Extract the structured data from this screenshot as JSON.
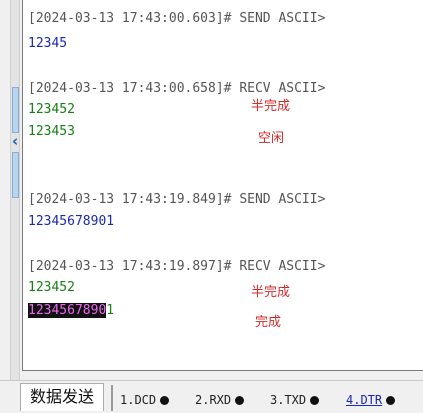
{
  "log": {
    "entries": [
      {
        "header": "[2024-03-13 17:43:00.603]# SEND ASCII>",
        "lines": [
          "12345"
        ]
      },
      {
        "header": "[2024-03-13 17:43:00.658]# RECV ASCII>",
        "lines": [
          "123452",
          "123453"
        ]
      },
      {
        "header": "[2024-03-13 17:43:19.849]# SEND ASCII>",
        "lines": [
          "12345678901"
        ]
      },
      {
        "header": "[2024-03-13 17:43:19.897]# RECV ASCII>",
        "lines": [
          "123452"
        ],
        "selected_text": "1234567890",
        "unselected_text": "1"
      }
    ]
  },
  "annotations": {
    "half_complete_1": "半完成",
    "idle": "空闲",
    "half_complete_2": "半完成",
    "complete": "完成"
  },
  "bottom_bar": {
    "tab_label": "数据发送",
    "signals": [
      {
        "label": "1.DCD",
        "icon": "dot-icon"
      },
      {
        "label": "2.RXD",
        "icon": "dot-icon"
      },
      {
        "label": "3.TXD",
        "icon": "dot-icon"
      },
      {
        "label": "4.DTR",
        "icon": "dot-icon",
        "active": true
      }
    ]
  },
  "colors": {
    "send_text": "#1a28b8",
    "recv_text": "#168016",
    "annotation": "#d42a2a",
    "selection_bg": "#111111",
    "selection_text": "#ee66ee"
  }
}
